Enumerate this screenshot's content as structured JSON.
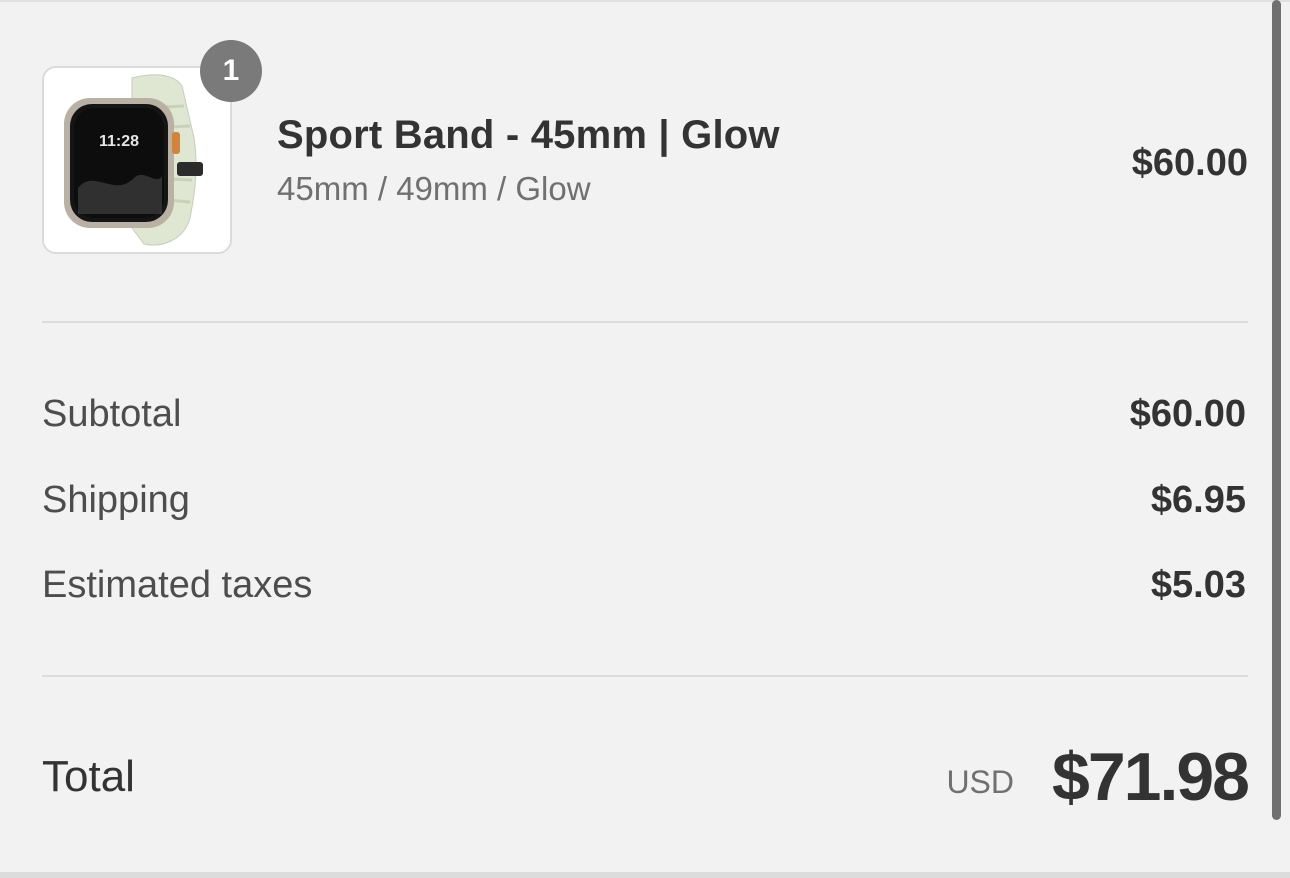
{
  "order_summary": {
    "items": [
      {
        "quantity": "1",
        "title": "Sport Band - 45mm | Glow",
        "variant": "45mm / 49mm / Glow",
        "price": "$60.00",
        "image_icon": "watch-band-product-image",
        "image_screen_time": "11:28"
      }
    ],
    "subtotal": {
      "label": "Subtotal",
      "value": "$60.00"
    },
    "shipping": {
      "label": "Shipping",
      "value": "$6.95"
    },
    "taxes": {
      "label": "Estimated taxes",
      "value": "$5.03"
    },
    "total": {
      "label": "Total",
      "currency": "USD",
      "value": "$71.98"
    }
  },
  "colors": {
    "background": "#f2f2f2",
    "text_primary": "#333333",
    "text_secondary": "#707070",
    "badge": "#7a7a7a",
    "divider": "#dcdcdc"
  }
}
